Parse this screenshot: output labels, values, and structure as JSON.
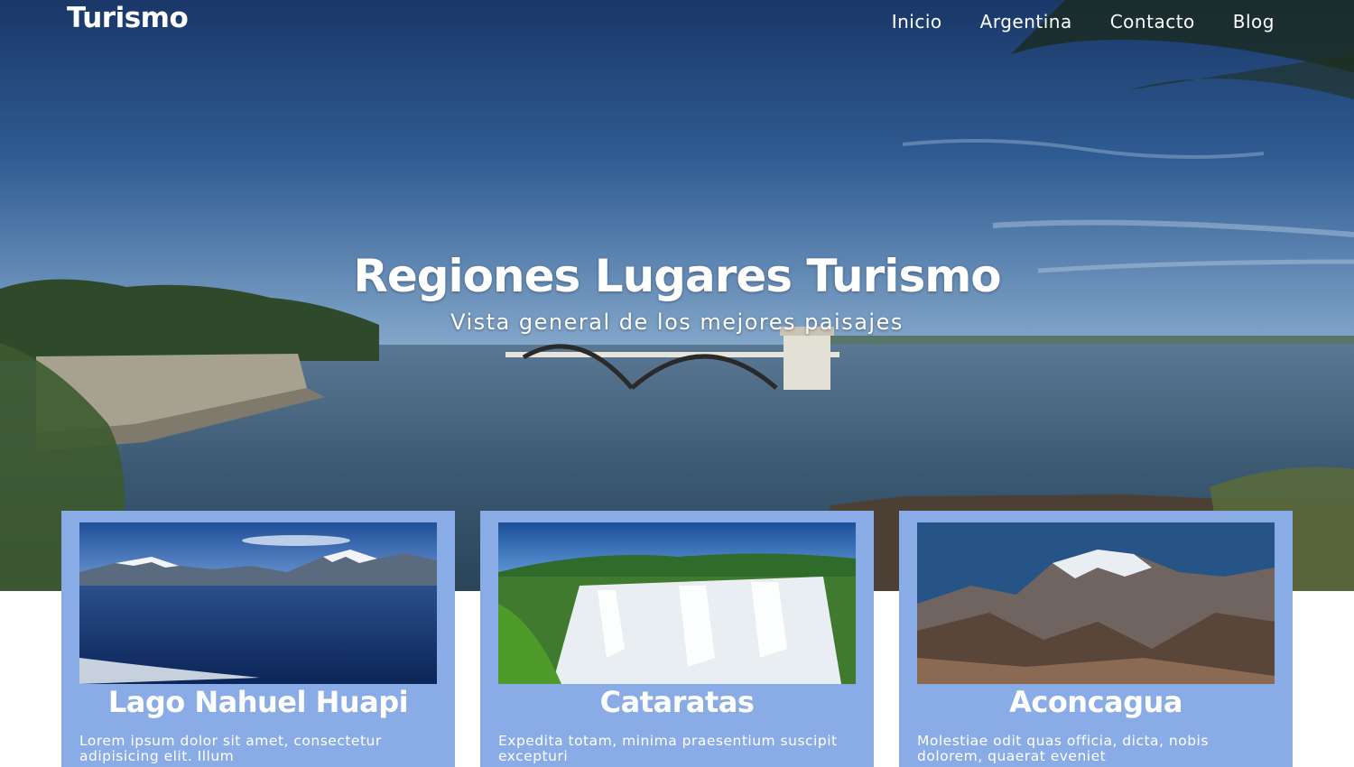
{
  "header": {
    "brand": "Turismo",
    "nav": [
      "Inicio",
      "Argentina",
      "Contacto",
      "Blog"
    ]
  },
  "hero": {
    "title": "Regiones Lugares Turismo",
    "subtitle": "Vista general de los mejores paisajes"
  },
  "cards": [
    {
      "title": "Lago Nahuel Huapi",
      "text": "Lorem ipsum dolor sit amet, consectetur adipisicing elit. Illum"
    },
    {
      "title": "Cataratas",
      "text": "Expedita totam, minima praesentium suscipit excepturi"
    },
    {
      "title": "Aconcagua",
      "text": "Molestiae odit quas officia, dicta, nobis dolorem, quaerat eveniet"
    }
  ],
  "colors": {
    "card_background": "#8aace6",
    "text": "#ffffff"
  }
}
